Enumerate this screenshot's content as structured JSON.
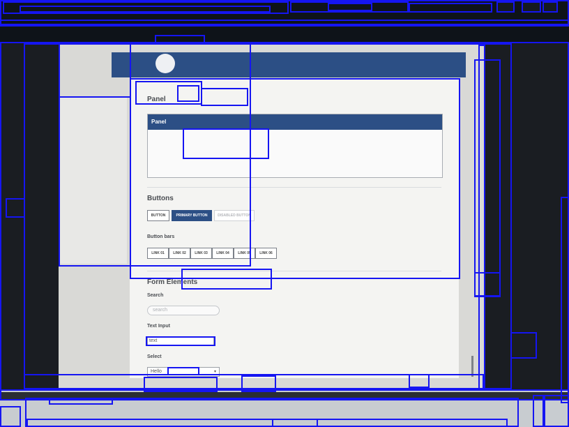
{
  "panel": {
    "page_heading": "Panel",
    "panel_title": "Panel"
  },
  "buttons": {
    "heading": "Buttons",
    "button": "BUTTON",
    "primary": "PRIMARY BUTTON",
    "disabled": "DISABLED BUTTON",
    "bars_label": "Button bars",
    "links": [
      "LINK 01",
      "LINK 02",
      "LINK 03",
      "LINK 04",
      "LINK 05",
      "LINK 06"
    ]
  },
  "form": {
    "heading": "Form Elements",
    "search_label": "Search",
    "search_placeholder": "search",
    "text_label": "Text Input",
    "text_value": "text",
    "select_label": "Select",
    "select_value": "Hello"
  },
  "colors": {
    "accent": "#2c4f85",
    "annotation": "#1515f2"
  }
}
